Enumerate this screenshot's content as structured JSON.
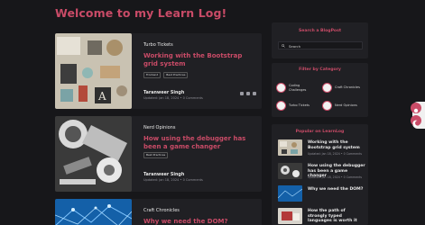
{
  "page": {
    "title": "Welcome to my Learn Log!"
  },
  "posts": [
    {
      "category": "Turbo Tickets",
      "title": "Working with the Bootstrap grid system",
      "tags": [
        "Frontend",
        "Best Practices"
      ],
      "author": "Taranweer Singh",
      "meta": "Updated: Jan 18, 2024  •  0 Comments"
    },
    {
      "category": "Nerd Opinions",
      "title": "How using the debugger has been a game changer",
      "tags": [
        "Best Practices"
      ],
      "author": "Taranweer Singh",
      "meta": "Updated: Jan 18, 2024  •  0 Comments"
    },
    {
      "category": "Craft Chronicles",
      "title": "Why we need the DOM?"
    }
  ],
  "sidebar": {
    "search": {
      "title": "Search a BlogPost",
      "placeholder": "Search"
    },
    "categories": {
      "title": "Filter by Category",
      "items": [
        {
          "label": "Coding\nChallenges",
          "icon": "category-icon"
        },
        {
          "label": "Craft Chronicles",
          "icon": "category-icon"
        },
        {
          "label": "Turbo Tickets",
          "icon": "category-icon"
        },
        {
          "label": "Nerd Opinions",
          "icon": "category-icon"
        }
      ]
    },
    "popular": {
      "title": "Popular on LearnLog",
      "items": [
        {
          "title": "Working with the Bootstrap grid system",
          "meta": "Updated: Jan 18, 2024  •  0 Comments"
        },
        {
          "title": "How using the debugger has been a game changer",
          "meta": "Updated: Jan 18, 2024  •  0 Comments"
        },
        {
          "title": "Why we need the DOM?",
          "meta": ""
        },
        {
          "title": "How the path of strongly typed languages is worth it",
          "meta": ""
        }
      ]
    }
  },
  "colors": {
    "accent": "#c94b67",
    "background": "#17171a",
    "card": "#202024"
  }
}
